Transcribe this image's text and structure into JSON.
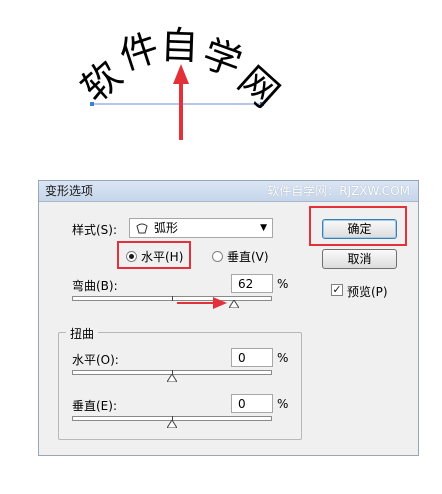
{
  "artwork": {
    "arc_text_chars": [
      "软",
      "件",
      "自",
      "学",
      "网"
    ]
  },
  "dialog": {
    "title": "变形选项",
    "watermark": "软件自学网：RJZXW.COM",
    "style_label": "样式(S):",
    "style_value": "弧形",
    "orientation": {
      "horizontal_label": "水平(H)",
      "vertical_label": "垂直(V)",
      "selected": "horizontal"
    },
    "bend": {
      "label": "弯曲(B):",
      "value": "62",
      "unit": "%",
      "percent": 62
    },
    "distortion": {
      "legend": "扭曲",
      "horizontal": {
        "label": "水平(O):",
        "value": "0",
        "unit": "%",
        "percent": 0
      },
      "vertical": {
        "label": "垂直(E):",
        "value": "0",
        "unit": "%",
        "percent": 0
      }
    },
    "buttons": {
      "ok": "确定",
      "cancel": "取消"
    },
    "preview": {
      "label": "预览(P)",
      "checked": true
    }
  },
  "colors": {
    "highlight": "#e3313a",
    "selection_blue": "#3b7fd6"
  }
}
